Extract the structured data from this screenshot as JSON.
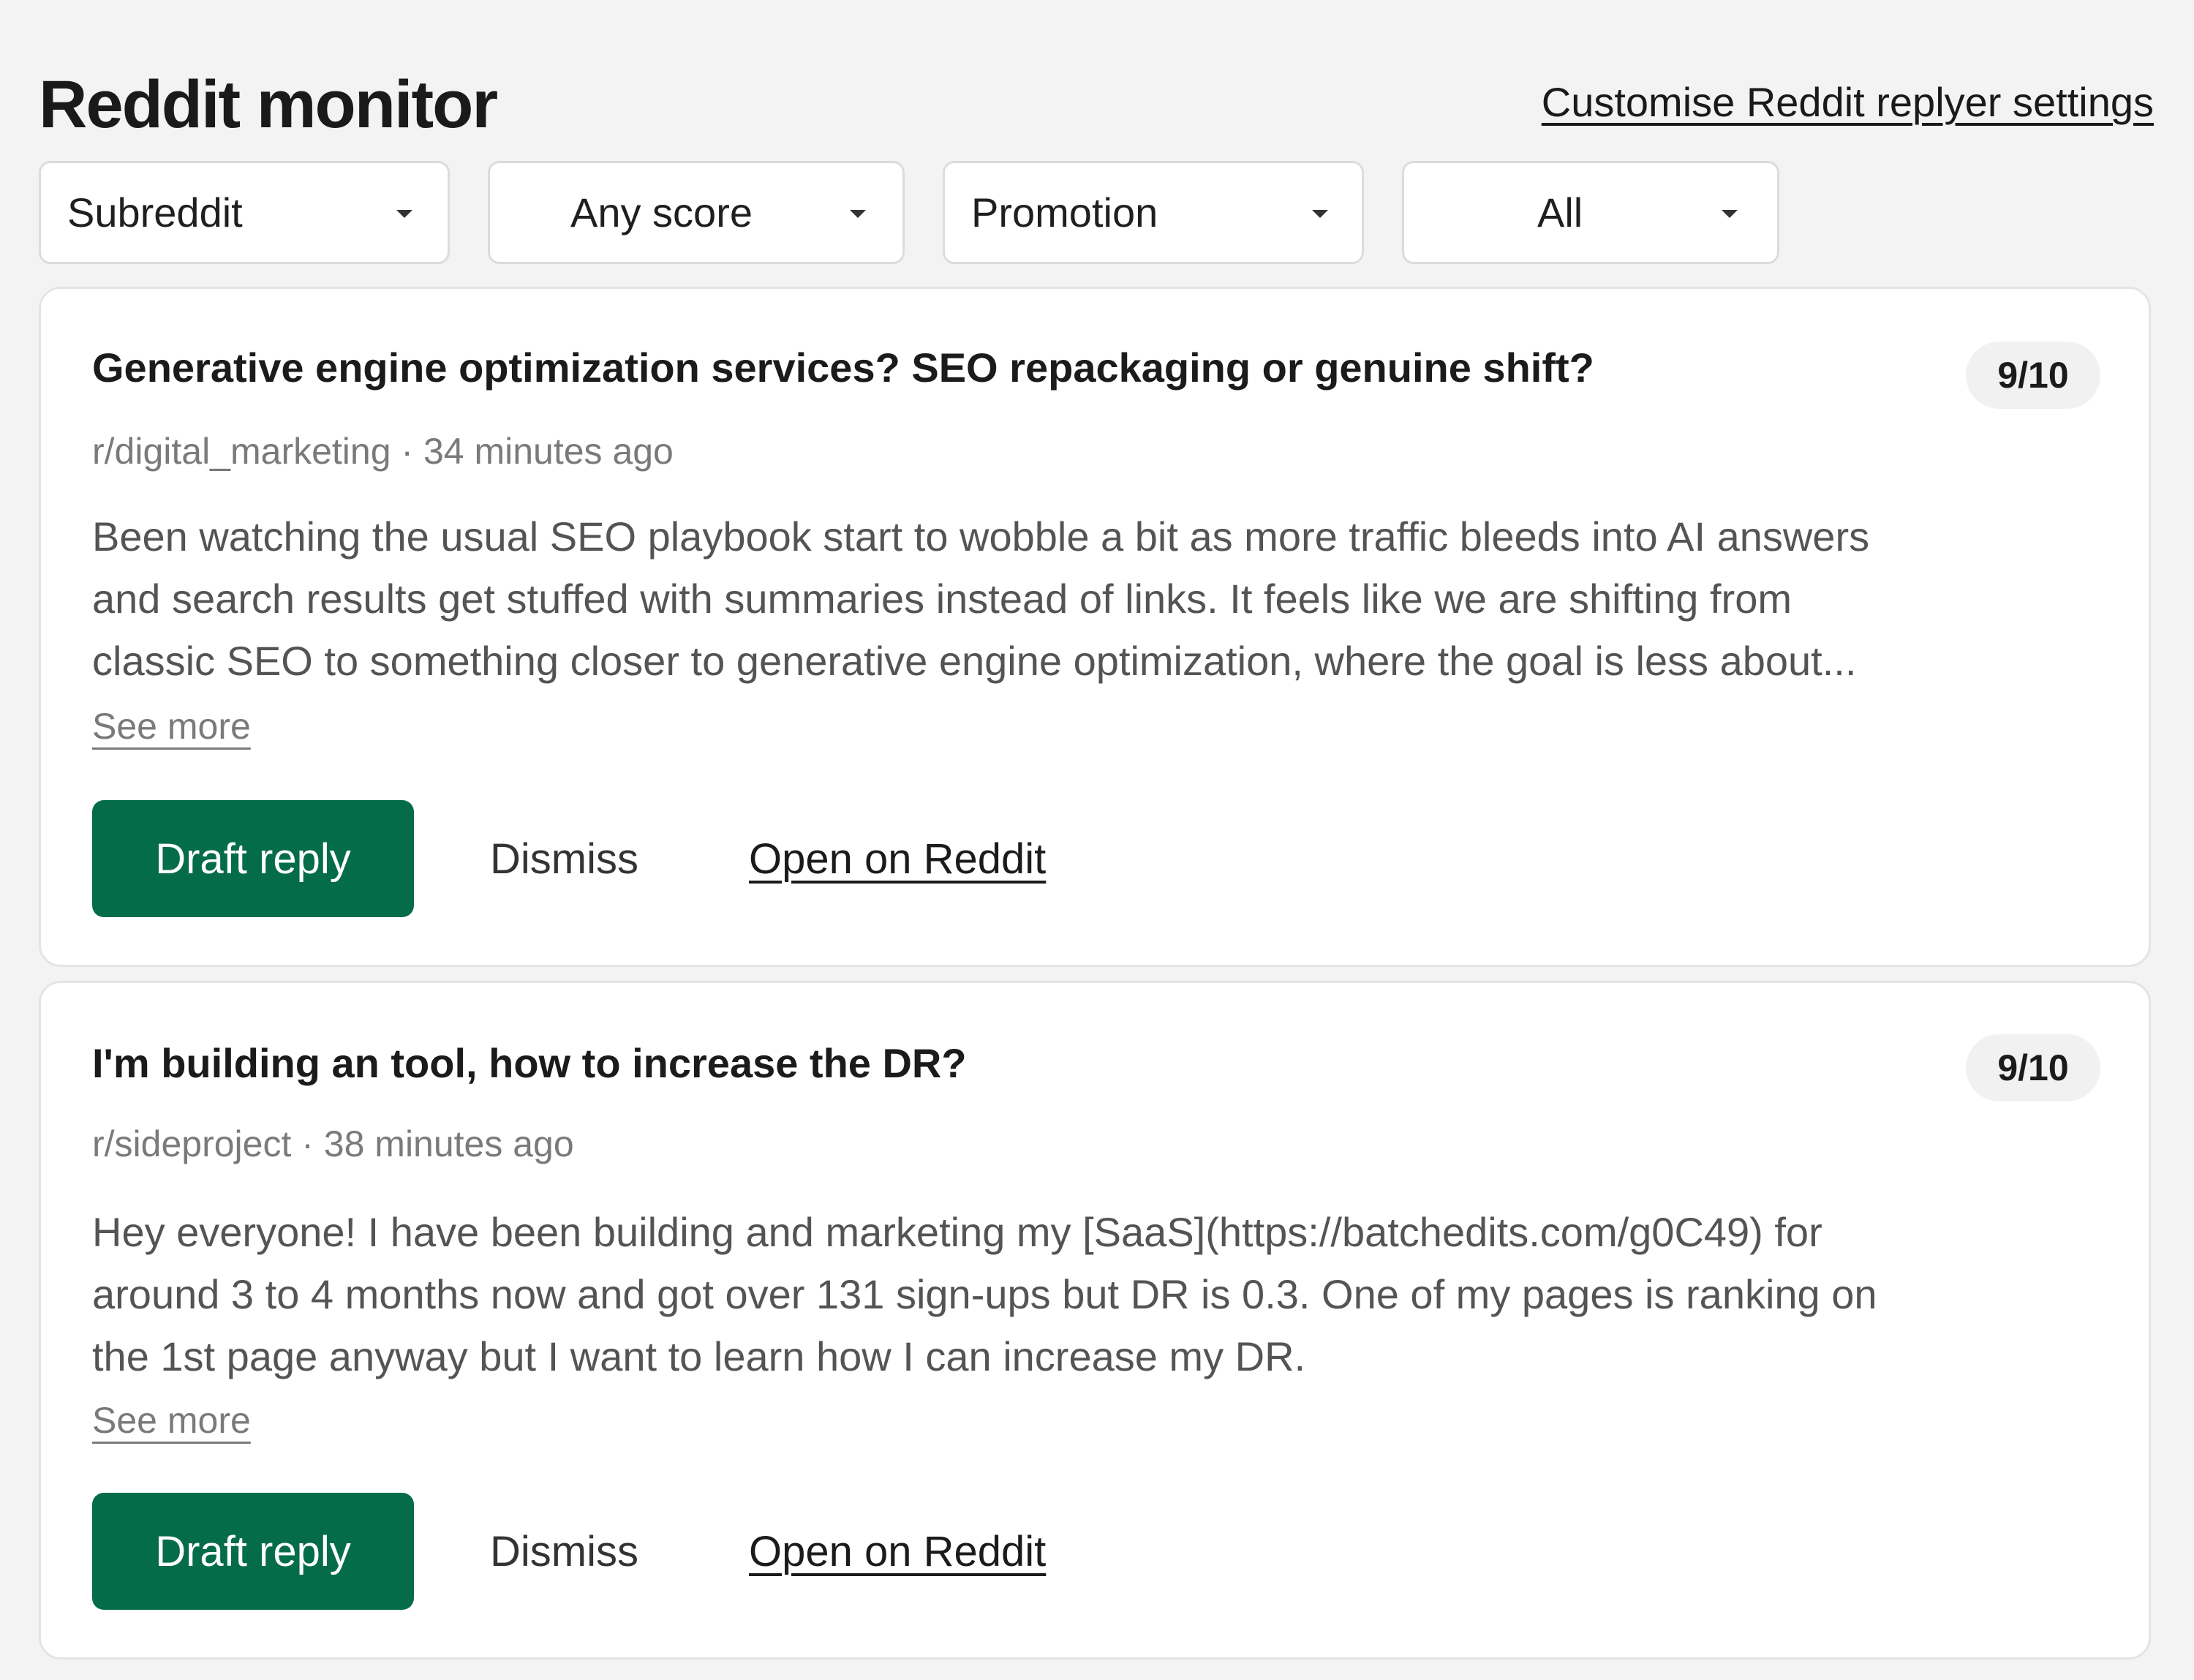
{
  "header": {
    "title": "Reddit monitor",
    "settings_link": "Customise Reddit replyer settings"
  },
  "filters": {
    "subreddit": "Subreddit",
    "score": "Any score",
    "category": "Promotion",
    "status": "All"
  },
  "posts": [
    {
      "title": "Generative engine optimization services? SEO repackaging or genuine shift?",
      "score": "9/10",
      "subreddit": "r/digital_marketing",
      "time": "34 minutes ago",
      "body_lines": [
        "Been watching the usual SEO playbook start to wobble a bit as more traffic bleeds into AI answers",
        "and search results get stuffed with summaries instead of links. It feels like we are shifting from",
        "classic SEO to something closer to generative engine optimization, where the goal is less about..."
      ],
      "see_more": "See more",
      "draft_label": "Draft reply",
      "dismiss_label": "Dismiss",
      "open_label": "Open on Reddit"
    },
    {
      "title": "I'm building an tool, how to increase the DR?",
      "score": "9/10",
      "subreddit": "r/sideproject",
      "time": "38 minutes ago",
      "body_lines": [
        "Hey everyone! I have been building and marketing my [SaaS](https://batchedits.com/g0C49) for",
        "around 3 to 4 months now and got over 131 sign-ups but DR is 0.3. One of my pages is ranking on",
        "the 1st page anyway but I want to learn how I can increase my DR."
      ],
      "see_more": "See more",
      "draft_label": "Draft reply",
      "dismiss_label": "Dismiss",
      "open_label": "Open on Reddit"
    }
  ],
  "meta_separator": " · ",
  "colors": {
    "primary_button": "#056c4a",
    "background": "#f3f3f3",
    "card": "#ffffff",
    "muted_text": "#7a7a7a"
  },
  "icons": {
    "dropdown": "caret-down-icon"
  }
}
